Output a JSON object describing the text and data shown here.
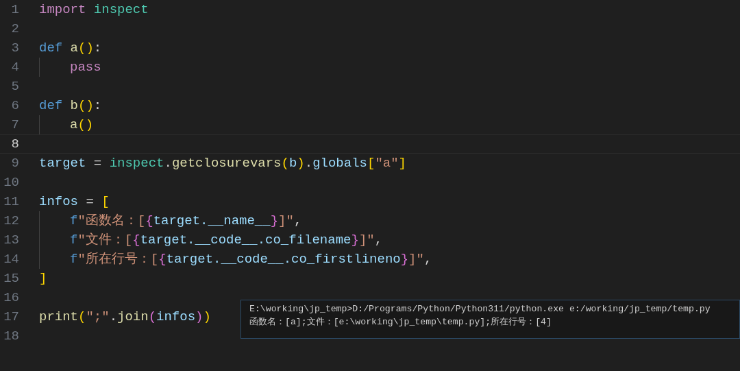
{
  "editor": {
    "lines": [
      {
        "number": "1",
        "current": false,
        "indented": false,
        "tokens": [
          {
            "text": "import ",
            "kind": "keyword"
          },
          {
            "text": "inspect",
            "kind": "module"
          }
        ]
      },
      {
        "number": "2",
        "current": false,
        "indented": false
      },
      {
        "number": "3",
        "current": false,
        "indented": false,
        "tokens": [
          {
            "text": "def ",
            "kind": "storage"
          },
          {
            "text": "a",
            "kind": "function"
          },
          {
            "text": "()",
            "kind": "bracket1"
          },
          {
            "text": ":",
            "kind": "plain"
          }
        ]
      },
      {
        "number": "4",
        "current": false,
        "indented": true,
        "tokens": [
          {
            "text": "pass",
            "kind": "keyword"
          }
        ]
      },
      {
        "number": "5",
        "current": false,
        "indented": false
      },
      {
        "number": "6",
        "current": false,
        "indented": false,
        "tokens": [
          {
            "text": "def ",
            "kind": "storage"
          },
          {
            "text": "b",
            "kind": "function"
          },
          {
            "text": "()",
            "kind": "bracket1"
          },
          {
            "text": ":",
            "kind": "plain"
          }
        ]
      },
      {
        "number": "7",
        "current": false,
        "indented": true,
        "tokens": [
          {
            "text": "a",
            "kind": "function"
          },
          {
            "text": "()",
            "kind": "bracket1"
          }
        ]
      },
      {
        "number": "8",
        "current": true,
        "indented": false
      },
      {
        "number": "9",
        "current": false,
        "indented": false,
        "tokens": [
          {
            "text": "target",
            "kind": "variable"
          },
          {
            "text": " = ",
            "kind": "plain"
          },
          {
            "text": "inspect",
            "kind": "module"
          },
          {
            "text": ".",
            "kind": "plain"
          },
          {
            "text": "getclosurevars",
            "kind": "function"
          },
          {
            "text": "(",
            "kind": "bracket1"
          },
          {
            "text": "b",
            "kind": "variable"
          },
          {
            "text": ")",
            "kind": "bracket1"
          },
          {
            "text": ".",
            "kind": "plain"
          },
          {
            "text": "globals",
            "kind": "variable"
          },
          {
            "text": "[",
            "kind": "bracket1"
          },
          {
            "text": "\"a\"",
            "kind": "string"
          },
          {
            "text": "]",
            "kind": "bracket1"
          }
        ]
      },
      {
        "number": "10",
        "current": false,
        "indented": false
      },
      {
        "number": "11",
        "current": false,
        "indented": false,
        "tokens": [
          {
            "text": "infos",
            "kind": "variable"
          },
          {
            "text": " = ",
            "kind": "plain"
          },
          {
            "text": "[",
            "kind": "bracket1"
          }
        ]
      },
      {
        "number": "12",
        "current": false,
        "indented": true,
        "tokens": [
          {
            "text": "f",
            "kind": "storage"
          },
          {
            "text": "\"函数名：[",
            "kind": "string"
          },
          {
            "text": "{",
            "kind": "bracket2"
          },
          {
            "text": "target.__name__",
            "kind": "variable"
          },
          {
            "text": "}",
            "kind": "bracket2"
          },
          {
            "text": "]\"",
            "kind": "string"
          },
          {
            "text": ",",
            "kind": "plain"
          }
        ]
      },
      {
        "number": "13",
        "current": false,
        "indented": true,
        "tokens": [
          {
            "text": "f",
            "kind": "storage"
          },
          {
            "text": "\"文件：[",
            "kind": "string"
          },
          {
            "text": "{",
            "kind": "bracket2"
          },
          {
            "text": "target.__code__.co_filename",
            "kind": "variable"
          },
          {
            "text": "}",
            "kind": "bracket2"
          },
          {
            "text": "]\"",
            "kind": "string"
          },
          {
            "text": ",",
            "kind": "plain"
          }
        ]
      },
      {
        "number": "14",
        "current": false,
        "indented": true,
        "tokens": [
          {
            "text": "f",
            "kind": "storage"
          },
          {
            "text": "\"所在行号：[",
            "kind": "string"
          },
          {
            "text": "{",
            "kind": "bracket2"
          },
          {
            "text": "target.__code__.co_firstlineno",
            "kind": "variable"
          },
          {
            "text": "}",
            "kind": "bracket2"
          },
          {
            "text": "]\"",
            "kind": "string"
          },
          {
            "text": ",",
            "kind": "plain"
          }
        ]
      },
      {
        "number": "15",
        "current": false,
        "indented": false,
        "tokens": [
          {
            "text": "]",
            "kind": "bracket1"
          }
        ]
      },
      {
        "number": "16",
        "current": false,
        "indented": false
      },
      {
        "number": "17",
        "current": false,
        "indented": false,
        "tokens": [
          {
            "text": "print",
            "kind": "function"
          },
          {
            "text": "(",
            "kind": "bracket1"
          },
          {
            "text": "\";\"",
            "kind": "string"
          },
          {
            "text": ".",
            "kind": "plain"
          },
          {
            "text": "join",
            "kind": "function"
          },
          {
            "text": "(",
            "kind": "bracket2"
          },
          {
            "text": "infos",
            "kind": "variable"
          },
          {
            "text": ")",
            "kind": "bracket2"
          },
          {
            "text": ")",
            "kind": "bracket1"
          }
        ]
      },
      {
        "number": "18",
        "current": false,
        "indented": false
      }
    ]
  },
  "terminal": {
    "lines": [
      "E:\\working\\jp_temp>D:/Programs/Python/Python311/python.exe e:/working/jp_temp/temp.py",
      "函数名：[a];文件：[e:\\working\\jp_temp\\temp.py];所在行号：[4]"
    ]
  }
}
